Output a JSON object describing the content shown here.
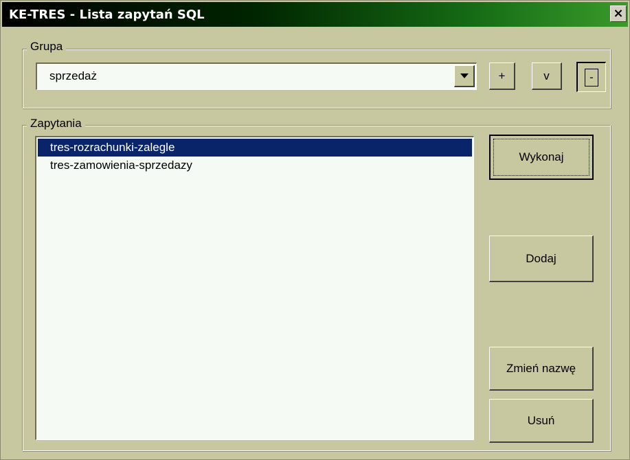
{
  "window": {
    "title": "KE-TRES - Lista zapytań SQL",
    "close_label": "×"
  },
  "group": {
    "legend": "Grupa",
    "selected": "sprzedaż",
    "buttons": {
      "add": "+",
      "confirm": "v",
      "remove": "-"
    }
  },
  "queries": {
    "legend": "Zapytania",
    "items": [
      {
        "label": "tres-rozrachunki-zalegle",
        "selected": true
      },
      {
        "label": "tres-zamowienia-sprzedazy",
        "selected": false
      }
    ]
  },
  "actions": {
    "execute": "Wykonaj",
    "add": "Dodaj",
    "rename": "Zmień nazwę",
    "delete": "Usuń"
  },
  "colors": {
    "window_bg": "#c8c8a0",
    "selection": "#0a246a",
    "list_bg": "#f5faf5"
  }
}
